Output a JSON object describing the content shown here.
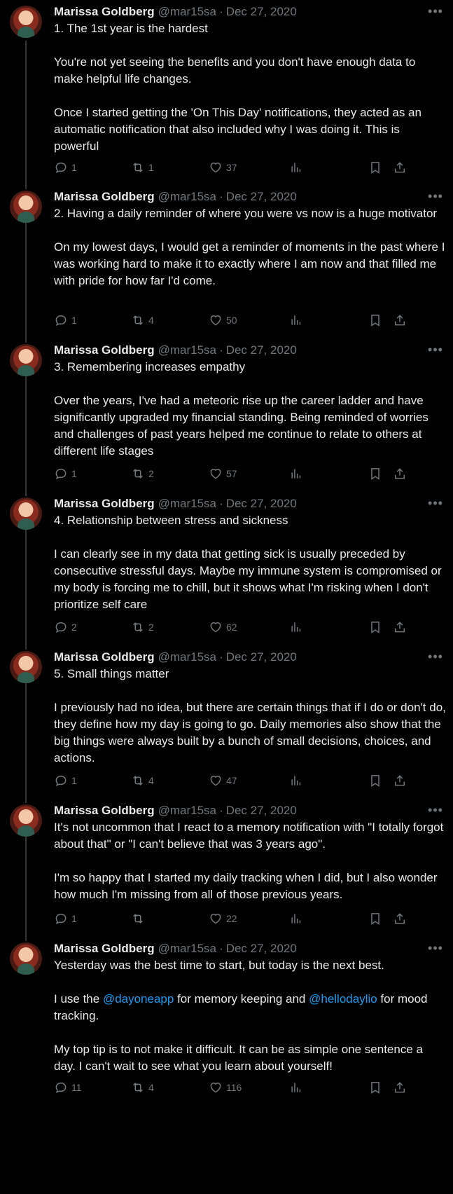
{
  "author": {
    "name": "Marissa Goldberg",
    "handle": "@mar15sa",
    "avatar_icon": "profile-photo"
  },
  "tweets": [
    {
      "date": "Dec 27, 2020",
      "paragraphs": [
        [
          "1. The 1st year is the hardest"
        ],
        [
          "You're not yet seeing the benefits and you don't have enough data to make helpful life changes."
        ],
        [
          "Once I started getting the 'On This Day' notifications, they acted as an automatic notification that also included why I was doing it. This is powerful"
        ]
      ],
      "replies": "1",
      "retweets": "1",
      "likes": "37"
    },
    {
      "date": "Dec 27, 2020",
      "paragraphs": [
        [
          "2. Having a daily reminder of where you were vs now is a huge motivator"
        ],
        [
          "On my lowest days, I would get a reminder of moments in the past where I was working hard to make it to exactly where I am now and that filled me with pride for how far I'd come."
        ]
      ],
      "replies": "1",
      "retweets": "4",
      "likes": "50"
    },
    {
      "date": "Dec 27, 2020",
      "paragraphs": [
        [
          "3. Remembering increases empathy"
        ],
        [
          "Over the years, I've had a meteoric rise up the career ladder and have significantly upgraded my financial standing. Being reminded of worries and challenges of past years helped me continue to relate to others at different life stages"
        ]
      ],
      "replies": "1",
      "retweets": "2",
      "likes": "57"
    },
    {
      "date": "Dec 27, 2020",
      "paragraphs": [
        [
          "4. Relationship between stress and sickness"
        ],
        [
          "I can clearly see in my data that getting sick is usually preceded by consecutive stressful days. Maybe my immune system is compromised or my body is forcing me to chill, but it shows what I'm risking when I don't prioritize self care"
        ]
      ],
      "replies": "2",
      "retweets": "2",
      "likes": "62"
    },
    {
      "date": "Dec 27, 2020",
      "paragraphs": [
        [
          "5. Small things matter"
        ],
        [
          "I previously had no idea, but there are certain things that if I do or don't do, they define how my day is going to go. Daily memories also show that the big things were always built by a bunch of small decisions, choices, and actions."
        ]
      ],
      "replies": "1",
      "retweets": "4",
      "likes": "47"
    },
    {
      "date": "Dec 27, 2020",
      "paragraphs": [
        [
          "It's not uncommon that I react to a memory notification with \"I totally forgot about that\" or \"I can't believe that was 3 years ago\"."
        ],
        [
          "I'm so happy that I started my daily tracking when I did, but I also wonder how much I'm missing from all of those previous years."
        ]
      ],
      "replies": "1",
      "retweets": "",
      "likes": "22"
    },
    {
      "date": "Dec 27, 2020",
      "paragraphs": [
        [
          "Yesterday was the best time to start, but today is the next best."
        ],
        [
          "I use the ",
          {
            "mention": "@dayoneapp"
          },
          " for memory keeping and ",
          {
            "mention": "@hellodaylio"
          },
          " for mood tracking."
        ],
        [
          "My top tip is to not make it difficult. It can be as simple one sentence a day. I can't wait to see what you learn about yourself!"
        ]
      ],
      "replies": "11",
      "retweets": "4",
      "likes": "116"
    }
  ],
  "separator": "·",
  "colors": {
    "background": "#000000",
    "text": "#e7e9ea",
    "muted": "#71767b",
    "link": "#1d9bf0",
    "thread_line": "#333639"
  }
}
